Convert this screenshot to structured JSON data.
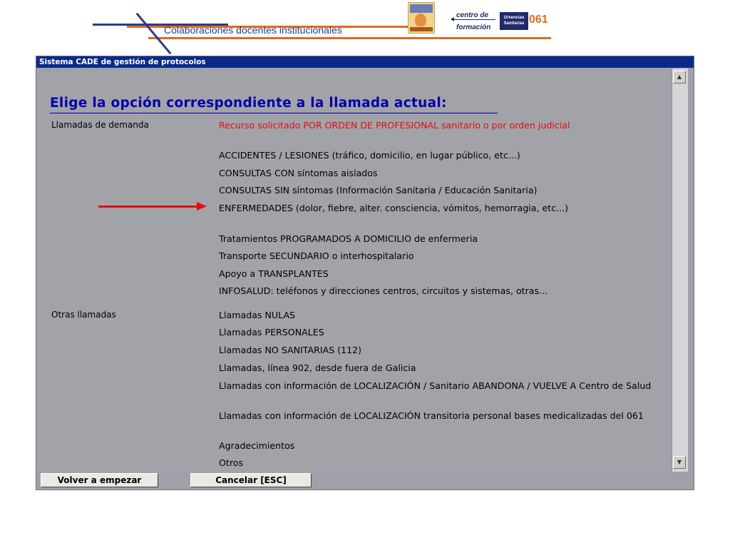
{
  "slide": {
    "title": "Colaboraciones docentes institucionales",
    "logo_centro_line1": "centro de",
    "logo_centro_line2": "formación",
    "logo_urx": "Urxencias Sanitarias",
    "logo_061": "061",
    "colors": {
      "orange": "#e06a1a",
      "navy": "#2b3a8f"
    }
  },
  "window": {
    "title": "Sistema CADE de gestión de protocolos",
    "heading": "Elige la opción correspondiente a la llamada actual:",
    "categories": [
      {
        "label": "Llamadas de demanda"
      },
      {
        "label": "Otras llamadas"
      }
    ],
    "options_demanda": [
      "Recurso solicitado POR ORDEN DE PROFESIONAL sanitario o por orden judicial",
      "ACCIDENTES / LESIONES (tráfico, domicilio, en lugar público, etc...)",
      "CONSULTAS CON síntomas aislados",
      "CONSULTAS SIN síntomas (Información Sanitaria / Educación Sanitaria)",
      "ENFERMEDADES (dolor, fiebre, alter. consciencia, vómitos, hemorragia, etc...)",
      "Tratamientos PROGRAMADOS A DOMICILIO de enfermeria",
      "Transporte SECUNDARIO o interhospitalario",
      "Apoyo a TRANSPLANTES",
      "INFOSALUD: teléfonos y direcciones centros, circuitos y sistemas, otras..."
    ],
    "options_otras": [
      "Llamadas NULAS",
      "Llamadas PERSONALES",
      "Llamadas NO SANITARIAS (112)",
      "Llamadas, línea 902, desde fuera de Galicia",
      "Llamadas con información de LOCALIZACIÓN / Sanitario ABANDONA / VUELVE A Centro de Salud",
      "Llamadas con información de LOCALIZACIÓN transitoria personal bases medicalizadas del 061",
      "Agradecimientos",
      "Otros"
    ],
    "buttons": {
      "restart": "Volver a empezar",
      "cancel": "Cancelar  [ESC]"
    },
    "colors": {
      "titlebar": "#0a2a8a",
      "heading": "#0000aa",
      "highlight_red": "#e01010",
      "background": "#a2a2a9"
    }
  }
}
